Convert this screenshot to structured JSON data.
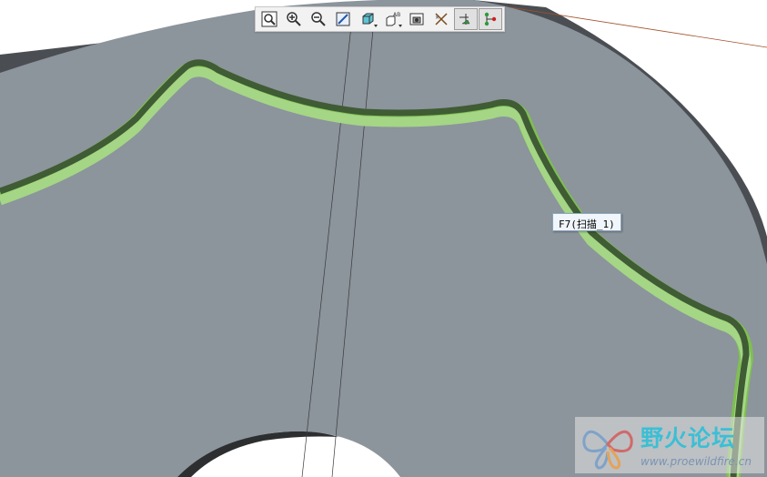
{
  "toolbar": {
    "buttons": [
      {
        "icon": "zoom-fit-icon"
      },
      {
        "icon": "zoom-in-icon"
      },
      {
        "icon": "zoom-out-icon"
      },
      {
        "icon": "repaint-icon"
      },
      {
        "icon": "display-style-icon",
        "dropdown": true
      },
      {
        "icon": "saved-view-icon",
        "dropdown": true
      },
      {
        "icon": "view-manager-icon"
      },
      {
        "icon": "datum-display-icon"
      },
      {
        "icon": "spin-center-icon",
        "active": true
      },
      {
        "icon": "tree-display-icon",
        "active": true
      }
    ]
  },
  "tooltip": {
    "text": "F7(扫描_1)"
  },
  "watermark": {
    "title": "野火论坛",
    "url": "www.proewildfire.cn"
  },
  "colors": {
    "model_surface": "#8c949c",
    "model_edge": "#555a5f",
    "sweep_outer": "#7fbf52",
    "sweep_inner": "#3f5c34",
    "background": "#ffffff"
  }
}
